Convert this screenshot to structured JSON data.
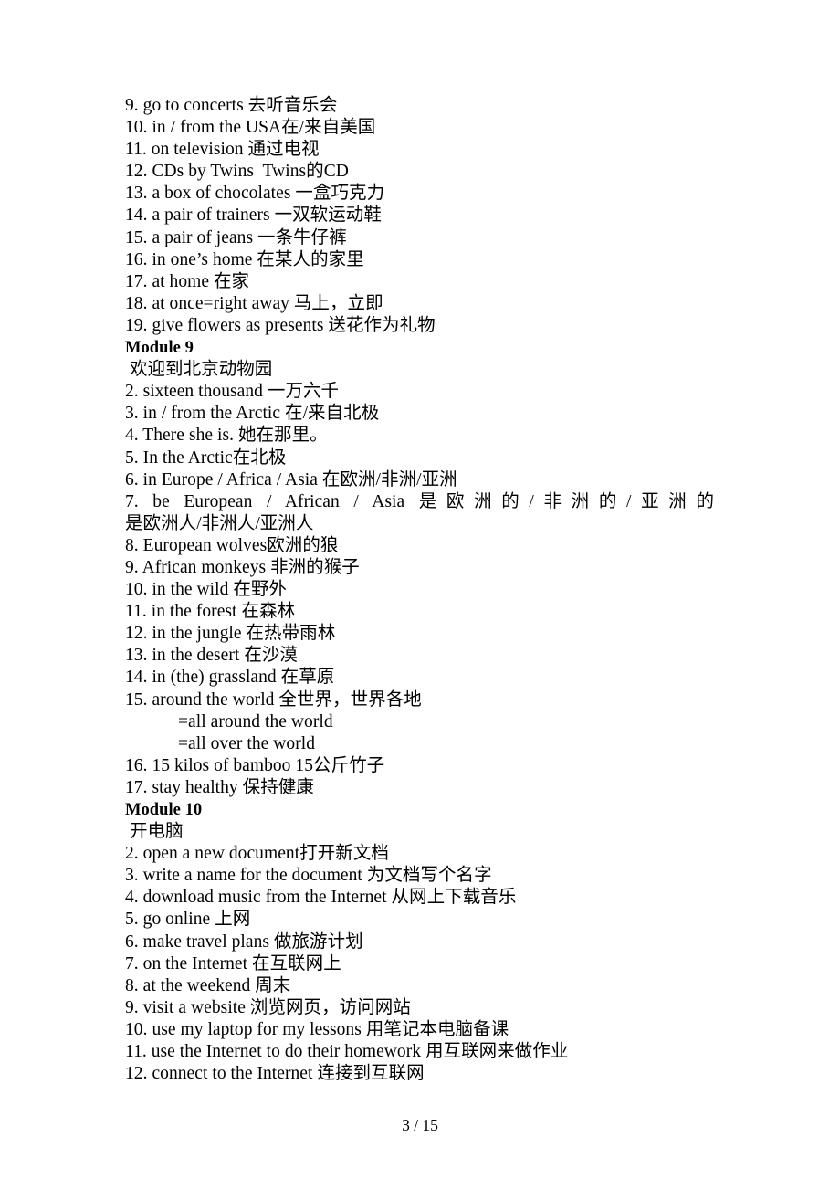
{
  "document": {
    "page_footer": "3 / 15",
    "blocks": [
      {
        "kind": "item",
        "text": "9. go to concerts 去听音乐会"
      },
      {
        "kind": "item",
        "text": "10. in / from the USA在/来自美国"
      },
      {
        "kind": "item",
        "text": "11. on television 通过电视"
      },
      {
        "kind": "item",
        "text": "12. CDs by Twins  Twins的CD"
      },
      {
        "kind": "item",
        "text": "13. a box of chocolates 一盒巧克力"
      },
      {
        "kind": "item",
        "text": "14. a pair of trainers 一双软运动鞋"
      },
      {
        "kind": "item",
        "text": "15. a pair of jeans 一条牛仔裤"
      },
      {
        "kind": "item",
        "text": "16. in one’s home 在某人的家里"
      },
      {
        "kind": "item",
        "text": "17. at home 在家"
      },
      {
        "kind": "item",
        "text": "18. at once=right away 马上，立即"
      },
      {
        "kind": "item",
        "text": "19. give flowers as presents 送花作为礼物"
      },
      {
        "kind": "heading",
        "text": "Module 9"
      },
      {
        "kind": "item",
        "text": " 欢迎到北京动物园"
      },
      {
        "kind": "item",
        "text": "2. sixteen thousand 一万六千"
      },
      {
        "kind": "item",
        "text": "3. in / from the Arctic 在/来自北极"
      },
      {
        "kind": "item",
        "text": "4. There she is. 她在那里。"
      },
      {
        "kind": "item",
        "text": "5. In the Arctic在北极"
      },
      {
        "kind": "item",
        "text": "6. in Europe / Africa / Asia 在欧洲/非洲/亚洲"
      },
      {
        "kind": "justified",
        "line1": "7. be European / African / Asia 是欧洲的/非洲的/亚洲的",
        "line2": "是欧洲人/非洲人/亚洲人"
      },
      {
        "kind": "item",
        "text": "8. European wolves欧洲的狼"
      },
      {
        "kind": "item",
        "text": "9. African monkeys 非洲的猴子"
      },
      {
        "kind": "item",
        "text": "10. in the wild 在野外"
      },
      {
        "kind": "item",
        "text": "11. in the forest 在森林"
      },
      {
        "kind": "item",
        "text": "12. in the jungle 在热带雨林"
      },
      {
        "kind": "item",
        "text": "13. in the desert 在沙漠"
      },
      {
        "kind": "item",
        "text": "14. in (the) grassland 在草原"
      },
      {
        "kind": "item",
        "text": "15. around the world 全世界，世界各地"
      },
      {
        "kind": "subitem",
        "text": "=all around the world"
      },
      {
        "kind": "subitem",
        "text": "=all over the world"
      },
      {
        "kind": "item",
        "text": "16. 15 kilos of bamboo 15公斤竹子"
      },
      {
        "kind": "item",
        "text": "17. stay healthy 保持健康"
      },
      {
        "kind": "heading",
        "text": "Module 10"
      },
      {
        "kind": "item",
        "text": " 开电脑"
      },
      {
        "kind": "item",
        "text": "2. open a new document打开新文档"
      },
      {
        "kind": "item",
        "text": "3. write a name for the document 为文档写个名字"
      },
      {
        "kind": "item",
        "text": "4. download music from the Internet 从网上下载音乐"
      },
      {
        "kind": "item",
        "text": "5. go online 上网"
      },
      {
        "kind": "item",
        "text": "6. make travel plans 做旅游计划"
      },
      {
        "kind": "item",
        "text": "7. on the Internet 在互联网上"
      },
      {
        "kind": "item",
        "text": "8. at the weekend 周末"
      },
      {
        "kind": "item",
        "text": "9. visit a website 浏览网页，访问网站"
      },
      {
        "kind": "item",
        "text": "10. use my laptop for my lessons 用笔记本电脑备课"
      },
      {
        "kind": "item",
        "text": "11. use the Internet to do their homework 用互联网来做作业"
      },
      {
        "kind": "item",
        "text": "12. connect to the Internet 连接到互联网"
      }
    ]
  }
}
